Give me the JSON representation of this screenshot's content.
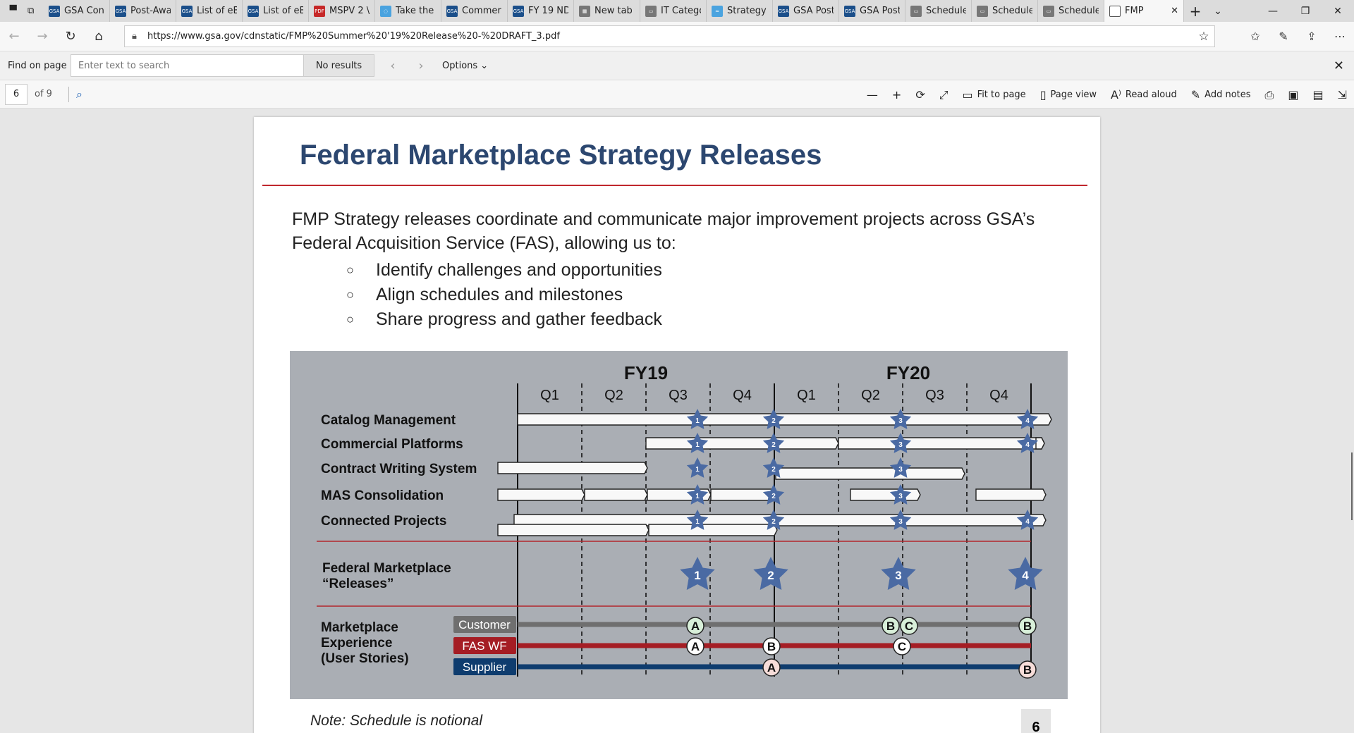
{
  "tabs": [
    {
      "label": "GSA Con",
      "color": "#1b4f8a",
      "fav": "GSA"
    },
    {
      "label": "Post-Awa",
      "color": "#1b4f8a",
      "fav": "GSA"
    },
    {
      "label": "List of eB",
      "color": "#1b4f8a",
      "fav": "GSA"
    },
    {
      "label": "List of eB",
      "color": "#1b4f8a",
      "fav": "GSA"
    },
    {
      "label": "MSPV 2 \\",
      "color": "#c62828",
      "fav": "PDF"
    },
    {
      "label": "Take the",
      "color": "#4aa3df",
      "fav": "◌"
    },
    {
      "label": "Commer",
      "color": "#1b4f8a",
      "fav": "GSA"
    },
    {
      "label": "FY 19 ND",
      "color": "#1b4f8a",
      "fav": "GSA"
    },
    {
      "label": "New tab",
      "color": "#777777",
      "fav": "▦"
    },
    {
      "label": "IT Catego",
      "color": "#777777",
      "fav": "▭"
    },
    {
      "label": "Strategy",
      "color": "#4aa3df",
      "fav": "≈"
    },
    {
      "label": "GSA Post",
      "color": "#1b4f8a",
      "fav": "GSA"
    },
    {
      "label": "GSA Post",
      "color": "#1b4f8a",
      "fav": "GSA"
    },
    {
      "label": "Schedule",
      "color": "#777777",
      "fav": "▭"
    },
    {
      "label": "Schedule",
      "color": "#777777",
      "fav": "▭"
    },
    {
      "label": "Schedule",
      "color": "#777777",
      "fav": "▭"
    }
  ],
  "active_tab": {
    "label": "FMP",
    "close": "✕"
  },
  "new_tab": "+",
  "tab_list": "⌄",
  "window": {
    "minimize": "—",
    "restore": "❐",
    "close": "✕"
  },
  "nav": {
    "back": "←",
    "forward": "→",
    "refresh": "↻",
    "home": "⌂"
  },
  "url": "https://www.gsa.gov/cdnstatic/FMP%20Summer%20'19%20Release%20-%20DRAFT_3.pdf",
  "find": {
    "label": "Find on page",
    "placeholder": "Enter text to search",
    "results": "No results",
    "prev": "‹",
    "next": "›",
    "options": "Options ⌄",
    "close": "✕"
  },
  "pdf": {
    "page": "6",
    "of": "of 9",
    "tools": [
      {
        "icon": "—",
        "label": "",
        "name": "zoom-out"
      },
      {
        "icon": "+",
        "label": "",
        "name": "zoom-in"
      },
      {
        "icon": "⟳",
        "label": "",
        "name": "rotate"
      },
      {
        "icon": "⤢",
        "label": "",
        "name": "fullscreen"
      },
      {
        "icon": "▭",
        "label": "Fit to page",
        "name": "fit-to-page"
      },
      {
        "icon": "▯",
        "label": "Page view",
        "name": "page-view"
      },
      {
        "icon": "A⁾",
        "label": "Read aloud",
        "name": "read-aloud"
      },
      {
        "icon": "✎",
        "label": "Add notes",
        "name": "add-notes"
      },
      {
        "icon": "⎙",
        "label": "",
        "name": "print"
      },
      {
        "icon": "▣",
        "label": "",
        "name": "save"
      },
      {
        "icon": "▤",
        "label": "",
        "name": "save-as"
      },
      {
        "icon": "⇲",
        "label": "",
        "name": "unpin"
      }
    ]
  },
  "doc": {
    "title": "Federal Marketplace Strategy Releases",
    "intro": "FMP Strategy releases coordinate and communicate major improvement projects across GSA’s Federal Acquisition Service (FAS), allowing us to:",
    "bullets": [
      "Identify challenges and opportunities",
      "Align schedules and milestones",
      "Share progress and gather feedback"
    ],
    "note": "Note: Schedule is notional",
    "page_number": "6"
  },
  "chart_data": {
    "type": "gantt",
    "fiscal_years": [
      "FY19",
      "FY20"
    ],
    "quarters": [
      "Q1",
      "Q2",
      "Q3",
      "Q4",
      "Q1",
      "Q2",
      "Q3",
      "Q4"
    ],
    "rows": [
      "Catalog Management",
      "Commercial Platforms",
      "Contract Writing System",
      "MAS Consolidation",
      "Connected Projects"
    ],
    "releases_label": [
      "Federal Marketplace",
      "“Releases”"
    ],
    "releases": [
      "1",
      "2",
      "3",
      "4"
    ],
    "experience_label": [
      "Marketplace",
      "Experience",
      "(User Stories)"
    ],
    "lanes": [
      {
        "name": "Customer",
        "color": "#6f6f6f",
        "stories": [
          "A",
          "B",
          "C",
          "B"
        ]
      },
      {
        "name": "FAS WF",
        "color": "#a51d24",
        "stories": [
          "A",
          "B",
          "C"
        ]
      },
      {
        "name": "Supplier",
        "color": "#0e3c6e",
        "stories": [
          "A",
          "B"
        ]
      }
    ],
    "colors": {
      "background": "#aaaeb4",
      "star": "#4a6aa3",
      "story_green": "#d8efd9",
      "story_white": "#ffffff",
      "story_pink": "#f7ddd9"
    }
  }
}
